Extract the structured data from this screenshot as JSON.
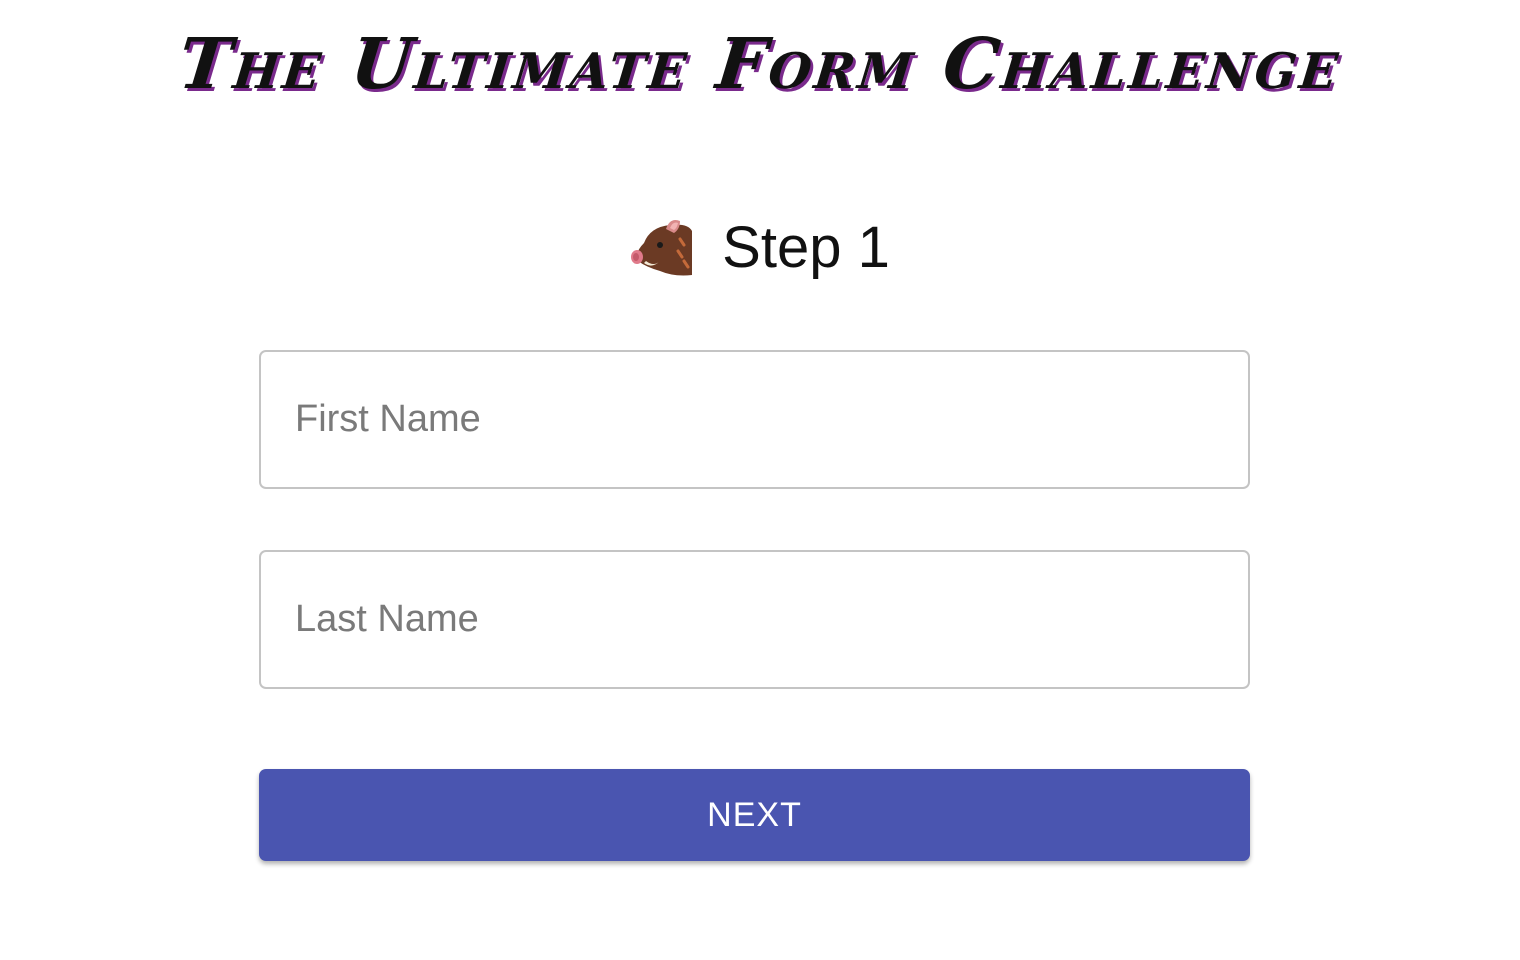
{
  "page": {
    "title": "The Ultimate Form Challenge"
  },
  "step": {
    "icon": "boar-icon",
    "label": "Step 1"
  },
  "form": {
    "first_name": {
      "placeholder": "First Name",
      "value": ""
    },
    "last_name": {
      "placeholder": "Last Name",
      "value": ""
    },
    "next_label": "NEXT"
  },
  "colors": {
    "accent": "#4a55b0",
    "title_shadow": "#7a2a8c",
    "field_border": "#c4c4c4"
  }
}
